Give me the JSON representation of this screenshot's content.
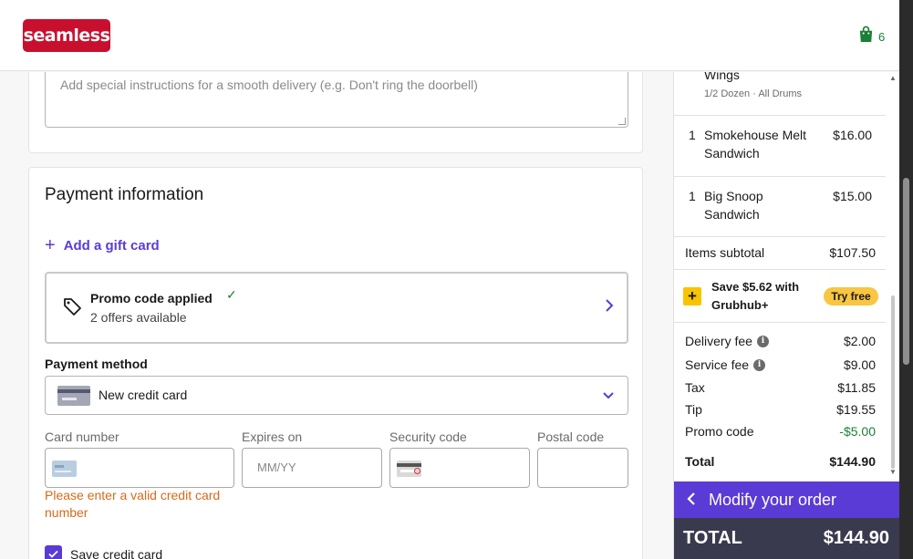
{
  "header": {
    "logo_text": "seamless",
    "bag_count": "6"
  },
  "instructions": {
    "placeholder": "Add special instructions for a smooth delivery (e.g. Don't ring the doorbell)"
  },
  "payment": {
    "title": "Payment information",
    "gift_card_label": "Add a gift card",
    "promo_title": "Promo code applied",
    "promo_subtitle": "2 offers available",
    "method_label": "Payment method",
    "method_value": "New credit card",
    "fields": {
      "card_number_label": "Card number",
      "expires_label": "Expires on",
      "expires_placeholder": "MM/YY",
      "security_label": "Security code",
      "postal_label": "Postal code"
    },
    "error_text": "Please enter a valid credit card number",
    "save_card_label": "Save credit card"
  },
  "order": {
    "items": [
      {
        "qty": "",
        "name": "Wings",
        "sub": "1/2 Dozen · All Drums",
        "price": ""
      },
      {
        "qty": "1",
        "name": "Smokehouse Melt Sandwich",
        "price": "$16.00"
      },
      {
        "qty": "1",
        "name": "Big Snoop Sandwich",
        "price": "$15.00"
      }
    ],
    "subtotal_label": "Items subtotal",
    "subtotal_value": "$107.50",
    "grubhub_promo": "Save $5.62 with Grubhub+",
    "try_free": "Try free",
    "fees": [
      {
        "label": "Delivery fee",
        "value": "$2.00",
        "info": true
      },
      {
        "label": "Service fee",
        "value": "$9.00",
        "info": true
      },
      {
        "label": "Tax",
        "value": "$11.85",
        "info": false
      },
      {
        "label": "Tip",
        "value": "$19.55",
        "info": false
      },
      {
        "label": "Promo code",
        "value": "-$5.00",
        "info": false
      }
    ],
    "total_label": "Total",
    "total_value": "$144.90",
    "modify_label": "Modify your order",
    "bottom_total_label": "TOTAL",
    "bottom_total_value": "$144.90"
  },
  "colors": {
    "brand": "#c8102e",
    "accent": "#5a3bd6",
    "error": "#d66a1a",
    "promo_green": "#1a7f37",
    "grubhub_yellow": "#f8c642"
  }
}
